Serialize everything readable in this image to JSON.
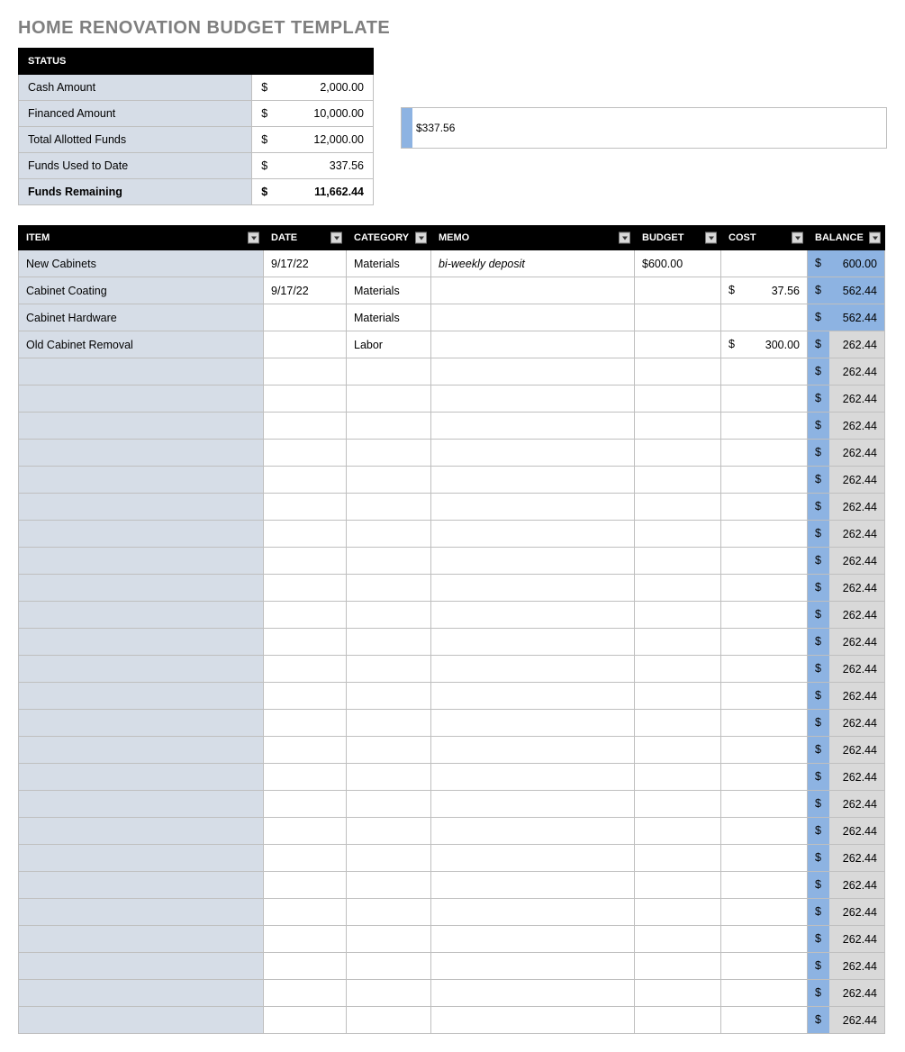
{
  "title": "HOME RENOVATION BUDGET TEMPLATE",
  "status": {
    "header": "STATUS",
    "rows": [
      {
        "label": "Cash Amount",
        "cur": "$",
        "value": "2,000.00",
        "bold": false
      },
      {
        "label": "Financed Amount",
        "cur": "$",
        "value": "10,000.00",
        "bold": false
      },
      {
        "label": "Total Allotted Funds",
        "cur": "$",
        "value": "12,000.00",
        "bold": false
      },
      {
        "label": "Funds Used to Date",
        "cur": "$",
        "value": "337.56",
        "bold": false
      },
      {
        "label": "Funds Remaining",
        "cur": "$",
        "value": "11,662.44",
        "bold": true
      }
    ]
  },
  "chart_data": {
    "type": "bar",
    "categories": [
      "Funds Used to Date"
    ],
    "values": [
      337.56
    ],
    "data_label": "$337.56",
    "title": "",
    "xlabel": "",
    "ylabel": "",
    "ylim": [
      0,
      12000
    ]
  },
  "grid": {
    "headers": {
      "item": "ITEM",
      "date": "DATE",
      "category": "CATEGORY",
      "memo": "MEMO",
      "budget": "BUDGET",
      "cost": "COST",
      "balance": "BALANCE"
    },
    "rows": [
      {
        "item": "New Cabinets",
        "date": "9/17/22",
        "category": "Materials",
        "memo": "bi-weekly deposit",
        "budget": "$600.00",
        "cost_cur": "",
        "cost": "",
        "bal_cur": "$",
        "balance": "600.00",
        "full": true
      },
      {
        "item": "Cabinet Coating",
        "date": "9/17/22",
        "category": "Materials",
        "memo": "",
        "budget": "",
        "cost_cur": "$",
        "cost": "37.56",
        "bal_cur": "$",
        "balance": "562.44",
        "full": true
      },
      {
        "item": "Cabinet Hardware",
        "date": "",
        "category": "Materials",
        "memo": "",
        "budget": "",
        "cost_cur": "",
        "cost": "",
        "bal_cur": "$",
        "balance": "562.44",
        "full": true
      },
      {
        "item": "Old Cabinet Removal",
        "date": "",
        "category": "Labor",
        "memo": "",
        "budget": "",
        "cost_cur": "$",
        "cost": "300.00",
        "bal_cur": "$",
        "balance": "262.44",
        "full": false
      },
      {
        "item": "",
        "date": "",
        "category": "",
        "memo": "",
        "budget": "",
        "cost_cur": "",
        "cost": "",
        "bal_cur": "$",
        "balance": "262.44",
        "full": false
      },
      {
        "item": "",
        "date": "",
        "category": "",
        "memo": "",
        "budget": "",
        "cost_cur": "",
        "cost": "",
        "bal_cur": "$",
        "balance": "262.44",
        "full": false
      },
      {
        "item": "",
        "date": "",
        "category": "",
        "memo": "",
        "budget": "",
        "cost_cur": "",
        "cost": "",
        "bal_cur": "$",
        "balance": "262.44",
        "full": false
      },
      {
        "item": "",
        "date": "",
        "category": "",
        "memo": "",
        "budget": "",
        "cost_cur": "",
        "cost": "",
        "bal_cur": "$",
        "balance": "262.44",
        "full": false
      },
      {
        "item": "",
        "date": "",
        "category": "",
        "memo": "",
        "budget": "",
        "cost_cur": "",
        "cost": "",
        "bal_cur": "$",
        "balance": "262.44",
        "full": false
      },
      {
        "item": "",
        "date": "",
        "category": "",
        "memo": "",
        "budget": "",
        "cost_cur": "",
        "cost": "",
        "bal_cur": "$",
        "balance": "262.44",
        "full": false
      },
      {
        "item": "",
        "date": "",
        "category": "",
        "memo": "",
        "budget": "",
        "cost_cur": "",
        "cost": "",
        "bal_cur": "$",
        "balance": "262.44",
        "full": false
      },
      {
        "item": "",
        "date": "",
        "category": "",
        "memo": "",
        "budget": "",
        "cost_cur": "",
        "cost": "",
        "bal_cur": "$",
        "balance": "262.44",
        "full": false
      },
      {
        "item": "",
        "date": "",
        "category": "",
        "memo": "",
        "budget": "",
        "cost_cur": "",
        "cost": "",
        "bal_cur": "$",
        "balance": "262.44",
        "full": false
      },
      {
        "item": "",
        "date": "",
        "category": "",
        "memo": "",
        "budget": "",
        "cost_cur": "",
        "cost": "",
        "bal_cur": "$",
        "balance": "262.44",
        "full": false
      },
      {
        "item": "",
        "date": "",
        "category": "",
        "memo": "",
        "budget": "",
        "cost_cur": "",
        "cost": "",
        "bal_cur": "$",
        "balance": "262.44",
        "full": false
      },
      {
        "item": "",
        "date": "",
        "category": "",
        "memo": "",
        "budget": "",
        "cost_cur": "",
        "cost": "",
        "bal_cur": "$",
        "balance": "262.44",
        "full": false
      },
      {
        "item": "",
        "date": "",
        "category": "",
        "memo": "",
        "budget": "",
        "cost_cur": "",
        "cost": "",
        "bal_cur": "$",
        "balance": "262.44",
        "full": false
      },
      {
        "item": "",
        "date": "",
        "category": "",
        "memo": "",
        "budget": "",
        "cost_cur": "",
        "cost": "",
        "bal_cur": "$",
        "balance": "262.44",
        "full": false
      },
      {
        "item": "",
        "date": "",
        "category": "",
        "memo": "",
        "budget": "",
        "cost_cur": "",
        "cost": "",
        "bal_cur": "$",
        "balance": "262.44",
        "full": false
      },
      {
        "item": "",
        "date": "",
        "category": "",
        "memo": "",
        "budget": "",
        "cost_cur": "",
        "cost": "",
        "bal_cur": "$",
        "balance": "262.44",
        "full": false
      },
      {
        "item": "",
        "date": "",
        "category": "",
        "memo": "",
        "budget": "",
        "cost_cur": "",
        "cost": "",
        "bal_cur": "$",
        "balance": "262.44",
        "full": false
      },
      {
        "item": "",
        "date": "",
        "category": "",
        "memo": "",
        "budget": "",
        "cost_cur": "",
        "cost": "",
        "bal_cur": "$",
        "balance": "262.44",
        "full": false
      },
      {
        "item": "",
        "date": "",
        "category": "",
        "memo": "",
        "budget": "",
        "cost_cur": "",
        "cost": "",
        "bal_cur": "$",
        "balance": "262.44",
        "full": false
      },
      {
        "item": "",
        "date": "",
        "category": "",
        "memo": "",
        "budget": "",
        "cost_cur": "",
        "cost": "",
        "bal_cur": "$",
        "balance": "262.44",
        "full": false
      },
      {
        "item": "",
        "date": "",
        "category": "",
        "memo": "",
        "budget": "",
        "cost_cur": "",
        "cost": "",
        "bal_cur": "$",
        "balance": "262.44",
        "full": false
      },
      {
        "item": "",
        "date": "",
        "category": "",
        "memo": "",
        "budget": "",
        "cost_cur": "",
        "cost": "",
        "bal_cur": "$",
        "balance": "262.44",
        "full": false
      },
      {
        "item": "",
        "date": "",
        "category": "",
        "memo": "",
        "budget": "",
        "cost_cur": "",
        "cost": "",
        "bal_cur": "$",
        "balance": "262.44",
        "full": false
      },
      {
        "item": "",
        "date": "",
        "category": "",
        "memo": "",
        "budget": "",
        "cost_cur": "",
        "cost": "",
        "bal_cur": "$",
        "balance": "262.44",
        "full": false
      },
      {
        "item": "",
        "date": "",
        "category": "",
        "memo": "",
        "budget": "",
        "cost_cur": "",
        "cost": "",
        "bal_cur": "$",
        "balance": "262.44",
        "full": false
      }
    ]
  }
}
